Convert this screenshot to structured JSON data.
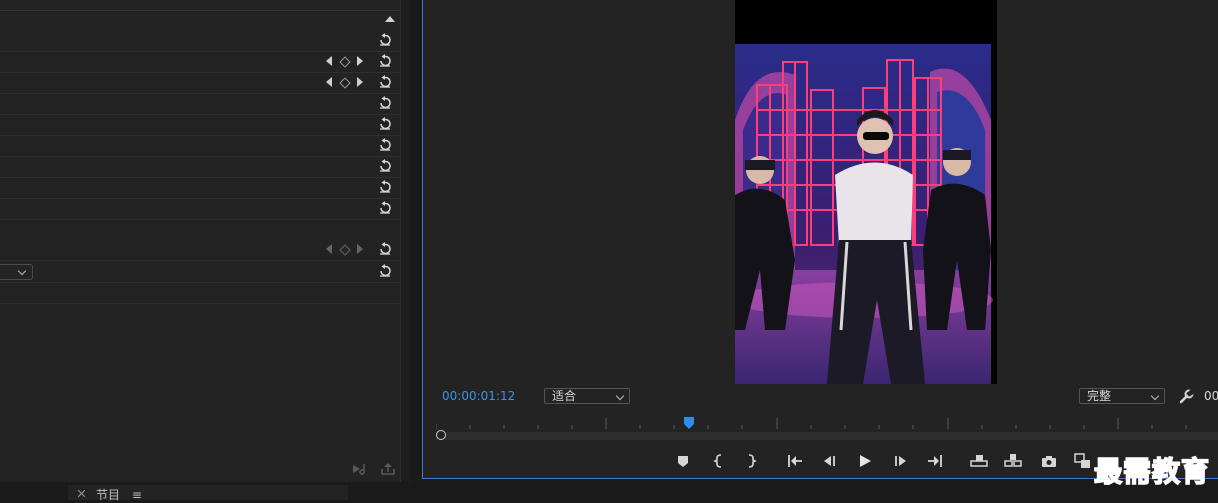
{
  "monitor": {
    "timecode": "00:00:01:12",
    "fit_select": "适合",
    "quality_select": "完整",
    "tail_timecode": "00",
    "playhead_position_fraction": 0.32
  },
  "bottom_tab": {
    "label": "节目",
    "menu_glyph": "≡"
  },
  "watermark": "最需教育",
  "effect_rows": [
    {
      "keyframes": false,
      "reset": true
    },
    {
      "keyframes": true,
      "reset": true
    },
    {
      "keyframes": true,
      "reset": true
    },
    {
      "keyframes": false,
      "reset": true
    },
    {
      "keyframes": false,
      "reset": true
    },
    {
      "keyframes": false,
      "reset": true
    },
    {
      "keyframes": false,
      "reset": true
    },
    {
      "keyframes": false,
      "reset": true
    },
    {
      "keyframes": false,
      "reset": true
    },
    {
      "keyframes": "dim",
      "reset": true
    },
    {
      "keyframes": false,
      "reset": true
    }
  ],
  "colors": {
    "panel_bg": "#232323",
    "accent_blue": "#3b93e8",
    "monitor_border": "#3c7bd0",
    "watermark_blue": "#2a63d9"
  },
  "icons": {
    "reset": "reset-icon",
    "keyframe_prev": "keyframe-prev-icon",
    "keyframe_add": "keyframe-add-icon",
    "keyframe_next": "keyframe-next-icon",
    "settings": "wrench-icon"
  }
}
